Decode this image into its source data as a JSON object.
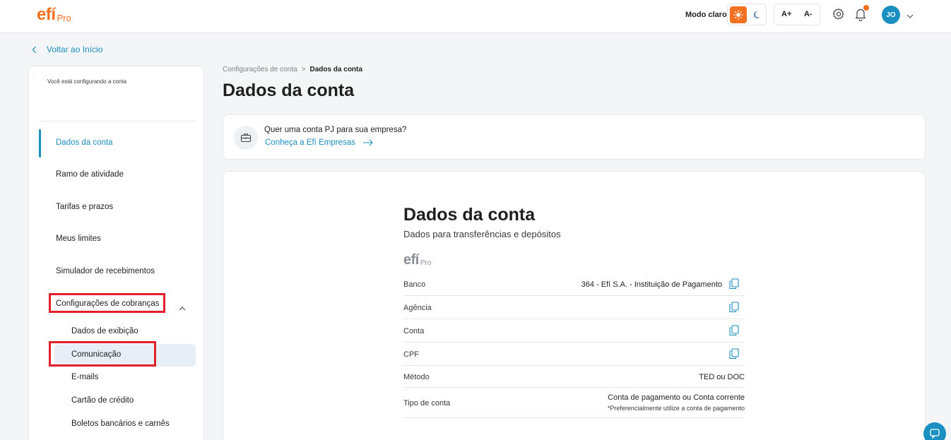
{
  "header": {
    "logo": "efí",
    "logo_suffix": "Pro",
    "mode_label": "Modo claro",
    "font_increase": "A+",
    "font_decrease": "A-",
    "avatar_initials": "JO",
    "accent_color": "#f37021",
    "brand_blue": "#1a8fc0"
  },
  "back_link": "Voltar ao Início",
  "sidebar": {
    "info": "Você está configurando a conta",
    "items": [
      {
        "label": "Dados da conta",
        "active": true
      },
      {
        "label": "Ramo de atividade"
      },
      {
        "label": "Tarifas e prazos"
      },
      {
        "label": "Meus limites"
      },
      {
        "label": "Simulador de recebimentos"
      },
      {
        "label": "Configurações de cobranças",
        "expanded": true
      }
    ],
    "subitems": [
      {
        "label": "Dados de exibição"
      },
      {
        "label": "Comunicação",
        "highlighted": true
      },
      {
        "label": "E-mails"
      },
      {
        "label": "Cartão de crédito"
      },
      {
        "label": "Boletos bancários e carnês"
      }
    ]
  },
  "breadcrumb": {
    "parent": "Configurações de conta",
    "separator": ">",
    "current": "Dados da conta"
  },
  "page_title": "Dados da conta",
  "banner": {
    "question": "Quer uma conta PJ para sua empresa?",
    "link": "Conheça a Efí Empresas"
  },
  "card": {
    "title": "Dados da conta",
    "subtitle": "Dados para transferências e depósitos",
    "logo": "efí",
    "logo_suffix": "Pro",
    "rows": [
      {
        "label": "Banco",
        "value": "364 - Efí S.A. - Instituição de Pagamento"
      },
      {
        "label": "Agência",
        "value": ""
      },
      {
        "label": "Conta",
        "value": ""
      },
      {
        "label": "CPF",
        "value": ""
      },
      {
        "label": "Método",
        "value": "TED ou DOC"
      },
      {
        "label": "Tipo de conta",
        "value": "Conta de pagamento ou Conta corrente",
        "note": "*Preferencialmente utilize a conta de pagamento"
      }
    ]
  }
}
